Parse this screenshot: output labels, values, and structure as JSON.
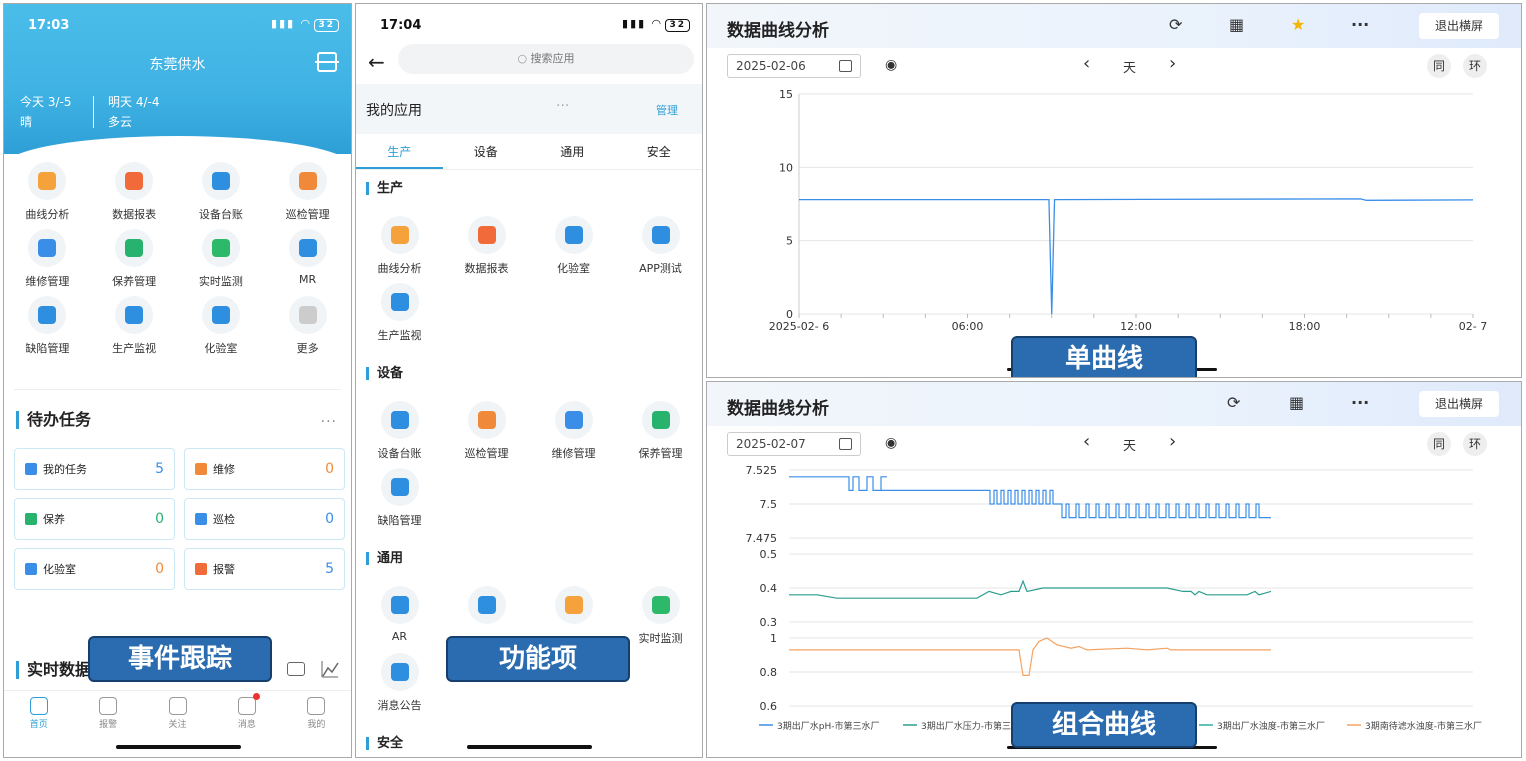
{
  "panel1": {
    "time": "17:03",
    "battery": "32",
    "title": "东莞供水",
    "today": "今天  3/-5",
    "today_w": "晴",
    "tomorrow": "明天  4/-4",
    "tomorrow_w": "多云",
    "apps": [
      {
        "label": "曲线分析",
        "icon": "chart-line-icon",
        "color": "#f6a23c"
      },
      {
        "label": "数据报表",
        "icon": "report-icon",
        "color": "#f06a3a"
      },
      {
        "label": "设备台账",
        "icon": "pump-icon",
        "color": "#2e8fe0"
      },
      {
        "label": "巡检管理",
        "icon": "inspect-icon",
        "color": "#f08a3a"
      },
      {
        "label": "维修管理",
        "icon": "wrench-icon",
        "color": "#3a8ee8"
      },
      {
        "label": "保养管理",
        "icon": "gear-icon",
        "color": "#27b36d"
      },
      {
        "label": "实时监测",
        "icon": "monitor-icon",
        "color": "#2cba6a"
      },
      {
        "label": "MR",
        "icon": "cube-icon",
        "color": "#2e8fe0"
      },
      {
        "label": "缺陷管理",
        "icon": "grid-icon",
        "color": "#2e8fe0"
      },
      {
        "label": "生产监视",
        "icon": "bar-chart-icon",
        "color": "#2e8fe0"
      },
      {
        "label": "化验室",
        "icon": "grid-icon",
        "color": "#2e8fe0"
      },
      {
        "label": "更多",
        "icon": "more-icon",
        "color": "#cccccc"
      }
    ],
    "todo_title": "待办任务",
    "more": "···",
    "todos": [
      {
        "label": "我的任务",
        "count": "5",
        "color": "#3a8ee8",
        "count_color": "#3a8ee8"
      },
      {
        "label": "维修",
        "count": "0",
        "color": "#f08a3a",
        "count_color": "#f08a3a"
      },
      {
        "label": "保养",
        "count": "0",
        "color": "#27b36d",
        "count_color": "#27b36d"
      },
      {
        "label": "巡检",
        "count": "0",
        "color": "#3a8ee8",
        "count_color": "#3a8ee8"
      },
      {
        "label": "化验室",
        "count": "0",
        "color": "#3a8ee8",
        "count_color": "#f08a3a"
      },
      {
        "label": "报警",
        "count": "5",
        "color": "#f06a3a",
        "count_color": "#3a8ee8"
      }
    ],
    "realtime_title": "实时数据",
    "tabs": [
      {
        "label": "首页"
      },
      {
        "label": "报警"
      },
      {
        "label": "关注"
      },
      {
        "label": "消息"
      },
      {
        "label": "我的"
      }
    ],
    "overlay": "事件跟踪"
  },
  "panel2": {
    "time": "17:04",
    "battery": "32",
    "search_placeholder": "搜索应用",
    "my_apps": "我的应用",
    "dots": "···",
    "manage": "管理",
    "tabs": [
      "生产",
      "设备",
      "通用",
      "安全"
    ],
    "sections": [
      {
        "title": "生产",
        "apps": [
          {
            "label": "曲线分析",
            "color": "#f6a23c"
          },
          {
            "label": "数据报表",
            "color": "#f06a3a"
          },
          {
            "label": "化验室",
            "color": "#2e8fe0"
          },
          {
            "label": "APP测试",
            "color": "#2e8fe0"
          },
          {
            "label": "生产监视",
            "color": "#2e8fe0"
          }
        ]
      },
      {
        "title": "设备",
        "apps": [
          {
            "label": "设备台账",
            "color": "#2e8fe0"
          },
          {
            "label": "巡检管理",
            "color": "#f08a3a"
          },
          {
            "label": "维修管理",
            "color": "#3a8ee8"
          },
          {
            "label": "保养管理",
            "color": "#27b36d"
          },
          {
            "label": "缺陷管理",
            "color": "#2e8fe0"
          }
        ]
      },
      {
        "title": "通用",
        "apps": [
          {
            "label": "AR",
            "color": "#2e8fe0"
          },
          {
            "label": "",
            "color": "#2e8fe0"
          },
          {
            "label": "",
            "color": "#f6a23c"
          },
          {
            "label": "实时监测",
            "color": "#2cba6a"
          },
          {
            "label": "消息公告",
            "color": "#2e8fe0"
          }
        ]
      },
      {
        "title": "安全",
        "apps": []
      }
    ],
    "overlay": "功能项"
  },
  "panel3": {
    "title": "数据曲线分析",
    "date": "2025-02-06",
    "period": "天",
    "prev": "‹",
    "next": "›",
    "btn_same": "同",
    "btn_ring": "环",
    "exit": "退出横屏",
    "overlay": "单曲线"
  },
  "panel4": {
    "title": "数据曲线分析",
    "date": "2025-02-07",
    "period": "天",
    "prev": "‹",
    "next": "›",
    "btn_same": "同",
    "btn_ring": "环",
    "exit": "退出横屏",
    "overlay": "组合曲线"
  },
  "chart_data": [
    {
      "type": "line",
      "ylim": [
        0,
        15
      ],
      "yticks": [
        0,
        5,
        10,
        15
      ],
      "xticks": [
        "2025-02- 6",
        "06:00",
        "12:00",
        "18:00",
        "02- 7"
      ],
      "series": [
        {
          "color": "#3a8ee8",
          "x": [
            0,
            8.9,
            9.0,
            9.1,
            9.2,
            20.0,
            20.2,
            24
          ],
          "values": [
            7.8,
            7.8,
            0,
            7.8,
            7.8,
            7.85,
            7.75,
            7.78
          ]
        }
      ]
    },
    {
      "type": "line",
      "ylim": [
        7.475,
        7.525
      ],
      "yticks": [
        7.475,
        7.5,
        7.525
      ],
      "series": [
        {
          "name": "3期出厂水pH-市第三水厂",
          "color": "#3a8ee8"
        }
      ]
    },
    {
      "type": "line",
      "ylim": [
        0.3,
        0.5
      ],
      "yticks": [
        0.3,
        0.4,
        0.5
      ],
      "series": [
        {
          "name": "3期出厂水压力-市第三",
          "color": "#2a9d8f"
        }
      ]
    },
    {
      "type": "line",
      "ylim": [
        0.6,
        1
      ],
      "yticks": [
        0.6,
        0.8,
        1
      ],
      "series": [
        {
          "name": "3期出厂水浊度-市第三水厂",
          "color": "#2ab0a0"
        },
        {
          "name": "3期南待滤水浊度-市第三水厂",
          "color": "#f4a261"
        }
      ]
    }
  ]
}
